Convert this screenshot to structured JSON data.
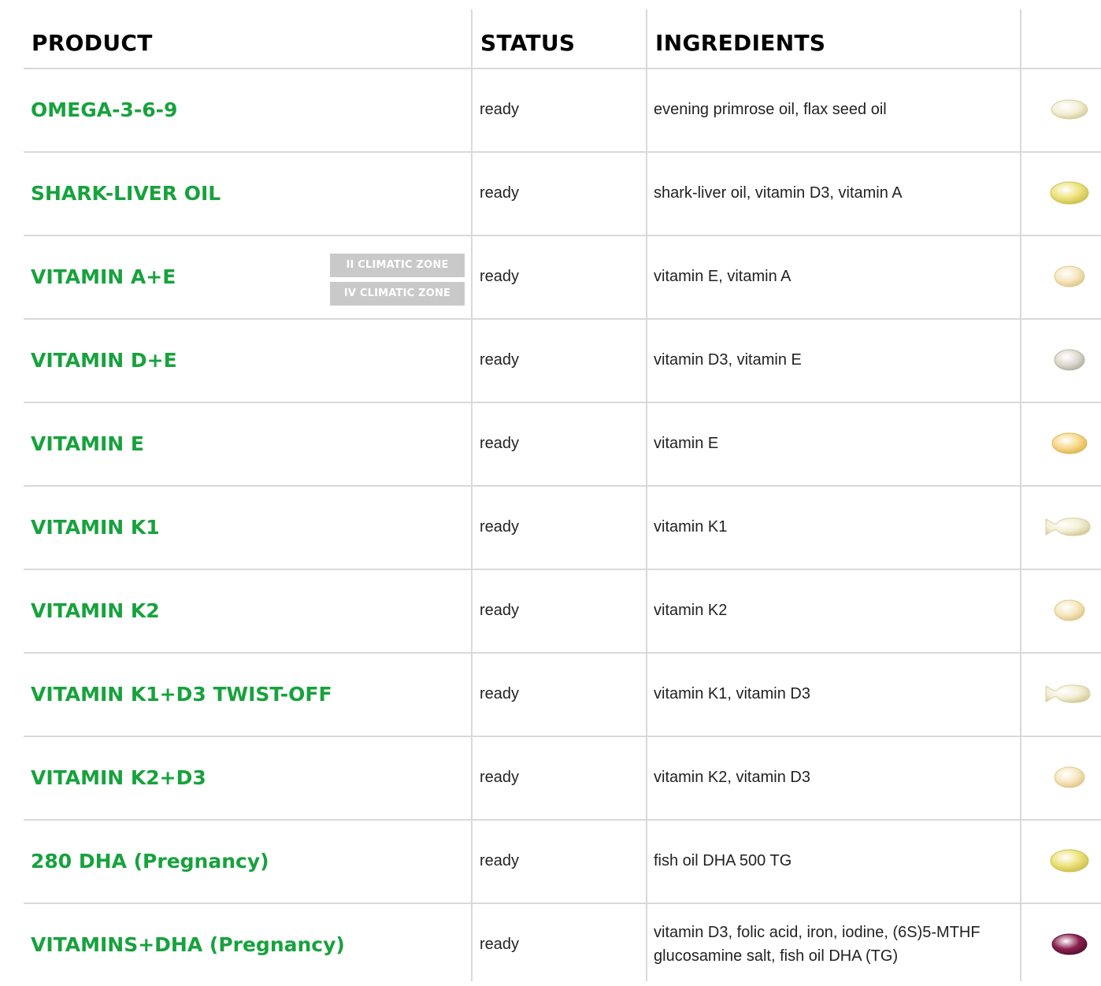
{
  "headers": {
    "product": "PRODUCT",
    "status": "STATUS",
    "ingredients": "INGREDIENTS"
  },
  "colors": {
    "product_name": "#17a23d",
    "zone_badge": "#c9c9c9",
    "grid": "#d9d9d9"
  },
  "rows": [
    {
      "product": "OMEGA-3-6-9",
      "status": "ready",
      "ingredients": "evening primrose oil, flax seed oil",
      "capsule_icon": "oval-softgel-pale-icon"
    },
    {
      "product": "SHARK-LIVER OIL",
      "status": "ready",
      "ingredients": "shark-liver oil, vitamin D3, vitamin A",
      "capsule_icon": "oval-softgel-yellow-icon"
    },
    {
      "product": "VITAMIN A+E",
      "status": "ready",
      "ingredients": "vitamin E, vitamin A",
      "capsule_icon": "round-softgel-cream-icon",
      "zones": [
        "II CLIMATIC ZONE",
        "IV CLIMATIC ZONE"
      ]
    },
    {
      "product": "VITAMIN D+E",
      "status": "ready",
      "ingredients": "vitamin D3, vitamin E",
      "capsule_icon": "round-softgel-grey-icon"
    },
    {
      "product": "VITAMIN E",
      "status": "ready",
      "ingredients": "vitamin E",
      "capsule_icon": "oval-softgel-amber-icon"
    },
    {
      "product": "VITAMIN K1",
      "status": "ready",
      "ingredients": "vitamin K1",
      "capsule_icon": "twist-off-softgel-icon"
    },
    {
      "product": "VITAMIN K2",
      "status": "ready",
      "ingredients": "vitamin K2",
      "capsule_icon": "round-softgel-cream-icon"
    },
    {
      "product": "VITAMIN K1+D3 TWIST-OFF",
      "status": "ready",
      "ingredients": "vitamin K1, vitamin D3",
      "capsule_icon": "twist-off-softgel-icon"
    },
    {
      "product": "VITAMIN K2+D3",
      "status": "ready",
      "ingredients": "vitamin K2, vitamin D3",
      "capsule_icon": "round-softgel-cream-icon"
    },
    {
      "product": "280 DHA (Pregnancy)",
      "status": "ready",
      "ingredients": "fish oil DHA 500 TG",
      "capsule_icon": "oval-softgel-yellow-icon"
    },
    {
      "product": "VITAMINS+DHA (Pregnancy)",
      "status": "ready",
      "ingredients": "vitamin D3, folic acid, iron, iodine, (6S)5-MTHF glucosamine salt, fish oil DHA (TG)",
      "capsule_icon": "oval-softgel-purple-icon"
    }
  ]
}
